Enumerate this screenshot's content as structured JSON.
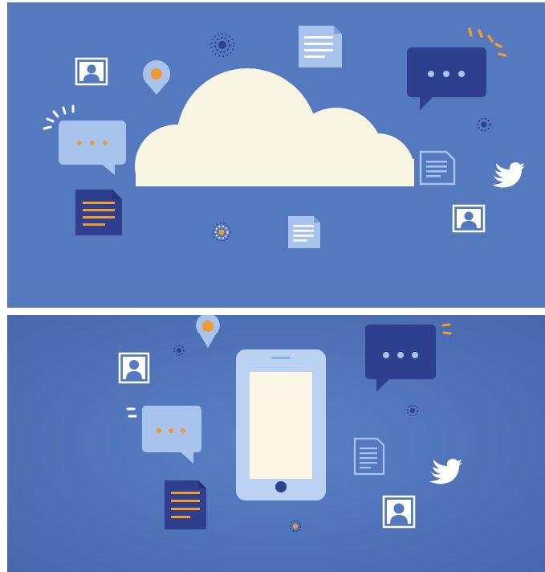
{
  "colors": {
    "background": "#5479bf",
    "background_dark": "#4c6fb4",
    "cloud": "#f8f5e3",
    "dark_blue": "#2e3f8e",
    "light_blue": "#8fb1e0",
    "pale_blue": "#a9c4ec",
    "orange": "#f09a32",
    "white": "#ffffff",
    "phone_frame": "#bcd2f2",
    "phone_screen": "#fbf6e6"
  },
  "panels": [
    {
      "name": "cloud-scene",
      "icons": [
        "profile-card-icon",
        "location-pin-icon",
        "sparkle-icon",
        "document-icon",
        "speech-bubble-icon",
        "chat-bubble-icon",
        "cloud-icon",
        "notes-document-icon",
        "twitter-bird-icon"
      ]
    },
    {
      "name": "smartphone-scene",
      "icons": [
        "location-pin-icon",
        "profile-card-icon",
        "smartphone-icon",
        "speech-bubble-icon",
        "chat-bubble-icon",
        "notes-document-icon",
        "document-icon",
        "twitter-bird-icon",
        "sparkle-icon"
      ]
    }
  ]
}
